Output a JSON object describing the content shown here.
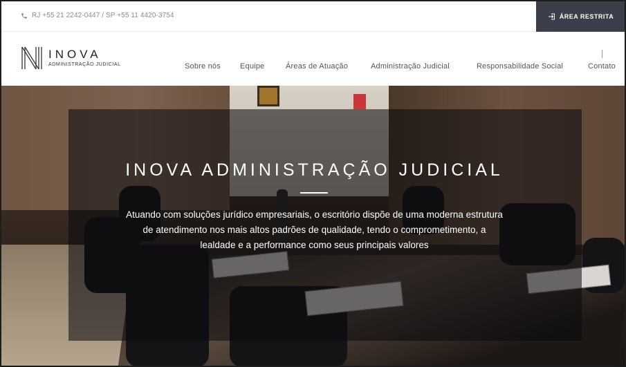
{
  "topbar": {
    "phone": "RJ +55 21 2242-0447 / SP +55 11 4420-3754",
    "restrita_label": "ÁREA RESTRITA"
  },
  "logo": {
    "name": "INOVA",
    "subtitle": "ADMINISTRAÇÃO JUDICIAL"
  },
  "menu": [
    {
      "label": "Sobre nós"
    },
    {
      "label": "Equipe"
    },
    {
      "label": "Áreas de Atuação"
    },
    {
      "label": "Administração Judicial"
    },
    {
      "label": "Responsabilidade Social"
    },
    {
      "label": "Contato"
    }
  ],
  "hero": {
    "title": "INOVA ADMINISTRAÇÃO JUDICIAL",
    "text": "Atuando com soluções jurídico empresariais, o escritório dispõe de uma moderna estrutura de atendimento nos mais altos padrões de qualidade, tendo o comprometimento, a lealdade e a performance como seus principais valores"
  },
  "colors": {
    "accent": "#9a7b55",
    "restrita_bg": "#3a3f4a"
  }
}
